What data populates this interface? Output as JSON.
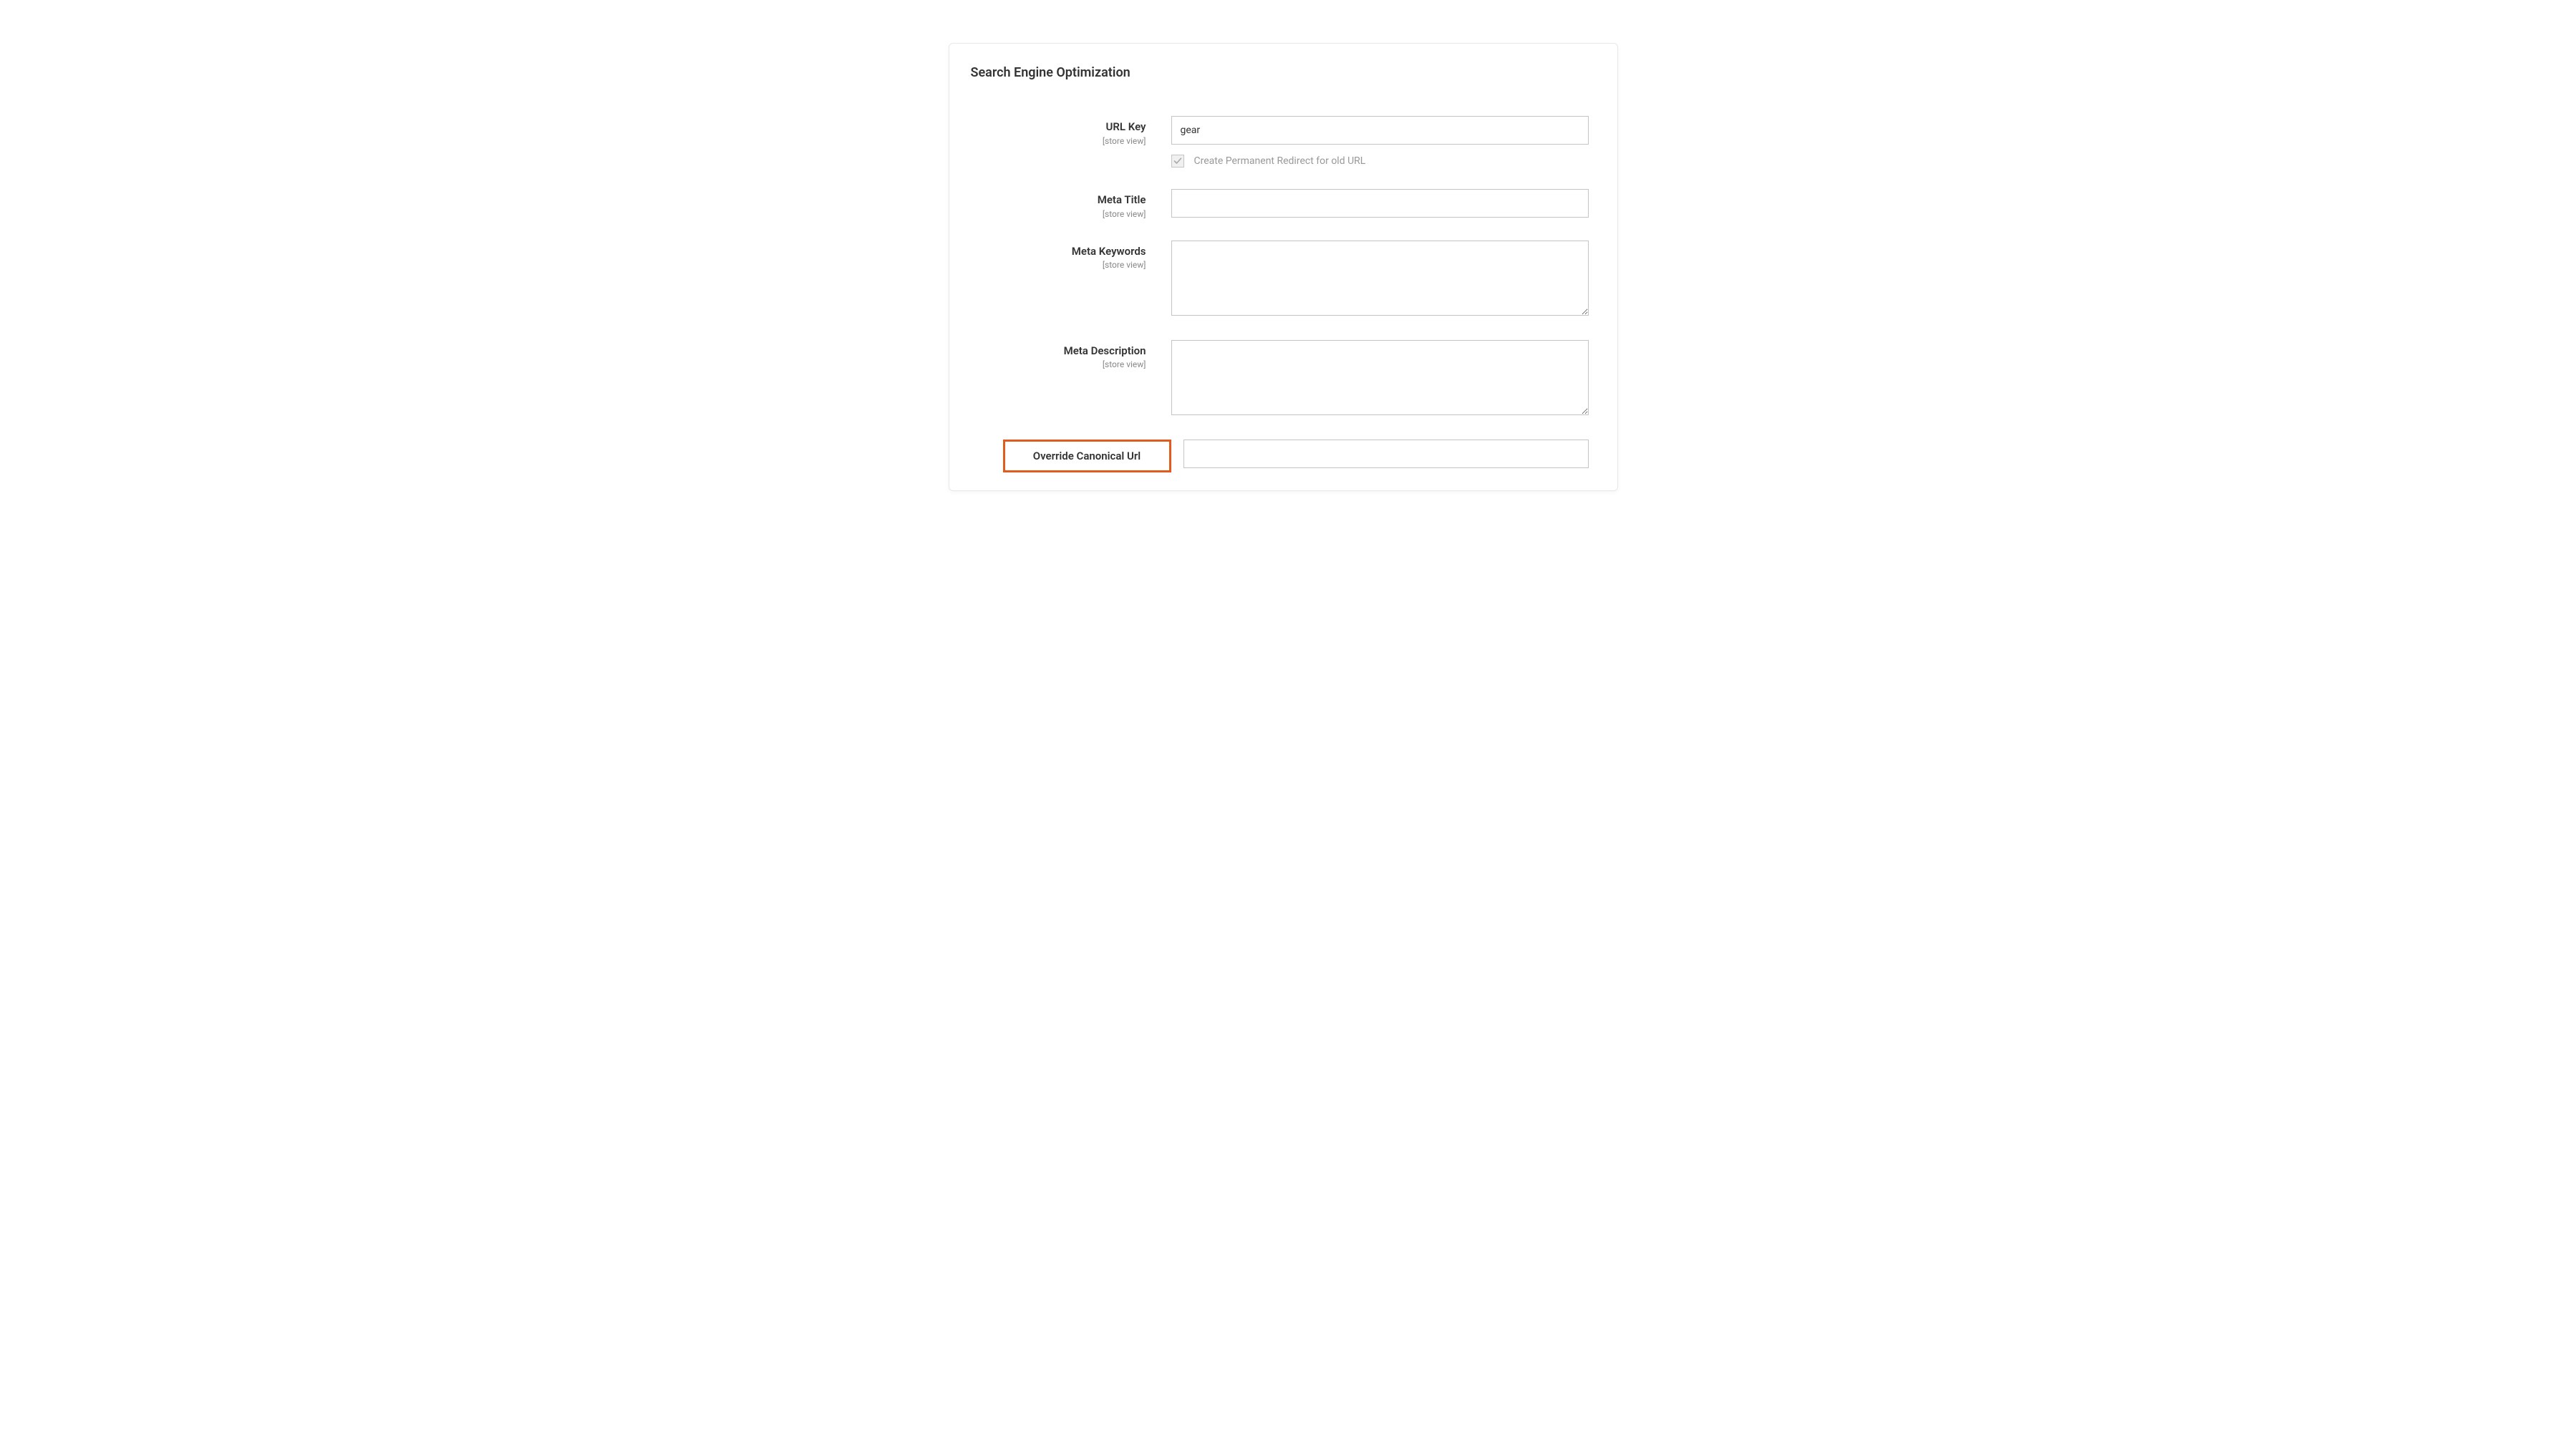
{
  "section": {
    "title": "Search Engine Optimization"
  },
  "fields": {
    "url_key": {
      "label": "URL Key",
      "scope": "[store view]",
      "value": "gear",
      "checkbox_label": "Create Permanent Redirect for old URL"
    },
    "meta_title": {
      "label": "Meta Title",
      "scope": "[store view]",
      "value": ""
    },
    "meta_keywords": {
      "label": "Meta Keywords",
      "scope": "[store view]",
      "value": ""
    },
    "meta_description": {
      "label": "Meta Description",
      "scope": "[store view]",
      "value": ""
    },
    "override_canonical": {
      "label": "Override Canonical Url",
      "value": ""
    }
  }
}
